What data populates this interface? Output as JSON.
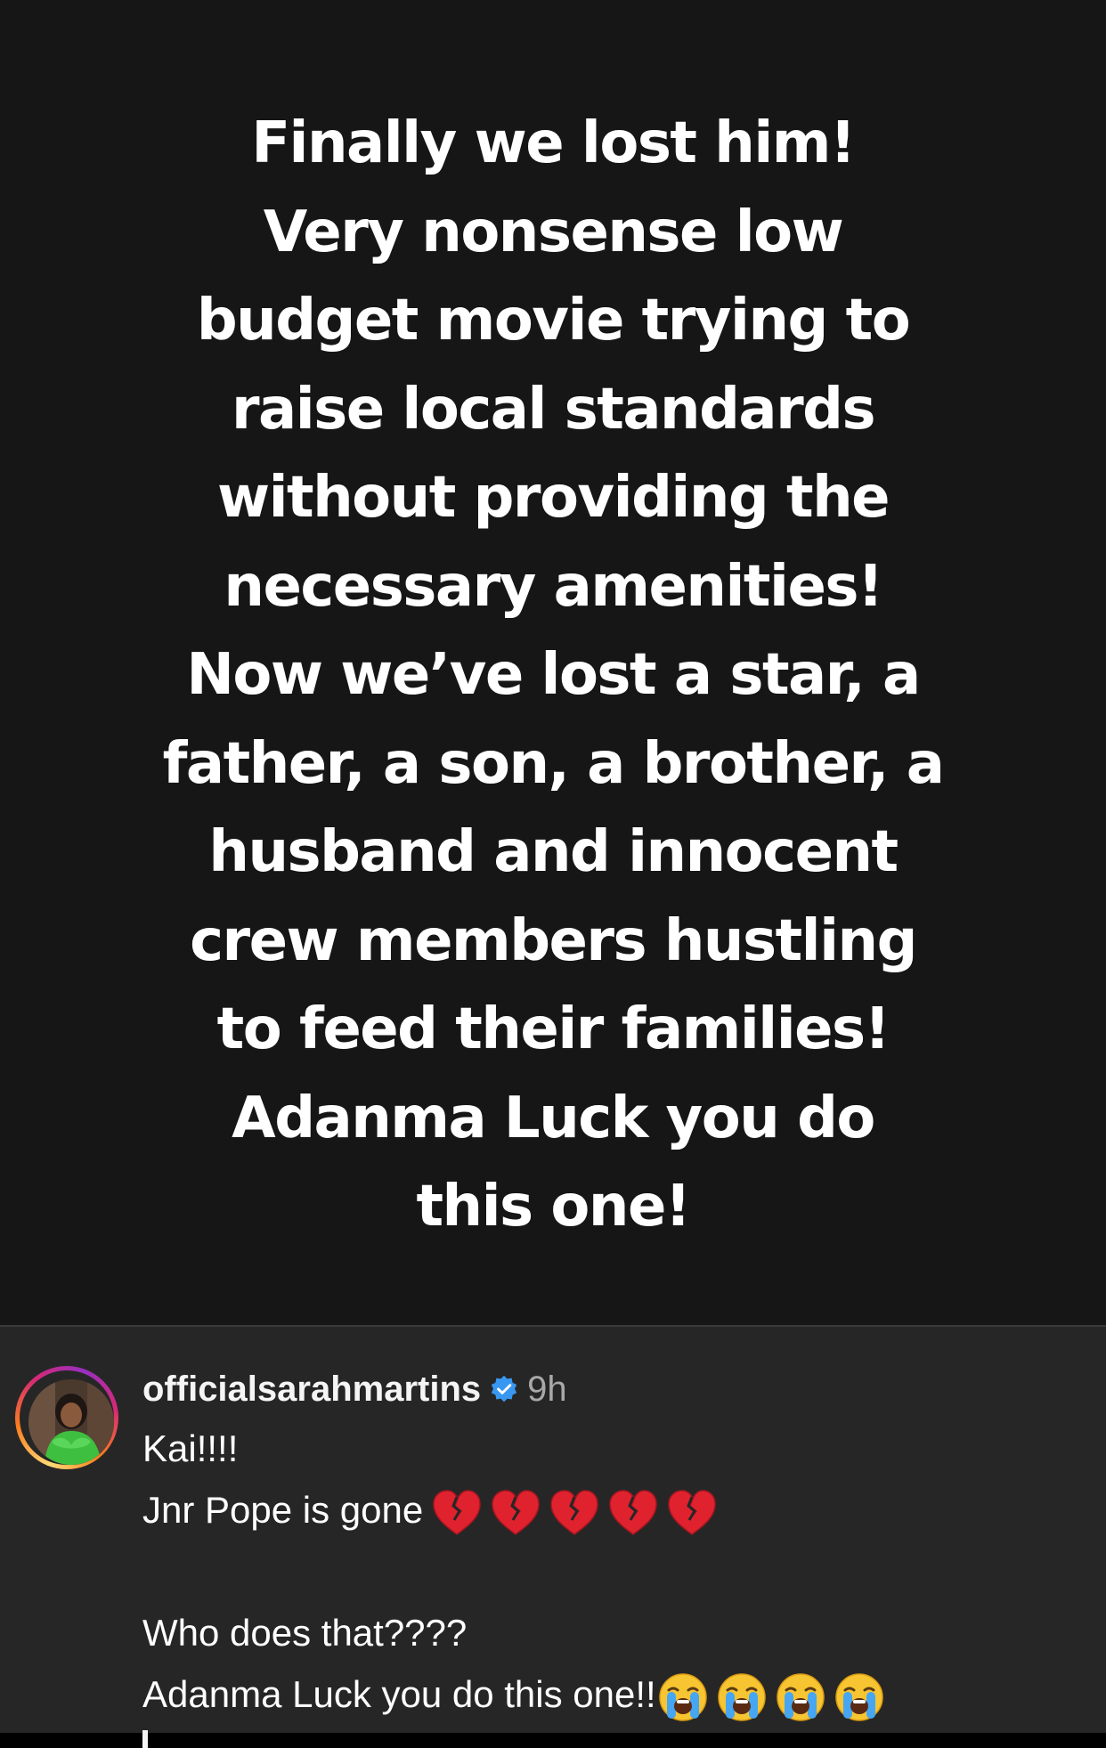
{
  "story": {
    "lines": [
      "Finally we lost him!",
      "Very nonsense low",
      "budget movie trying to",
      "raise local standards",
      "without providing the",
      "necessary amenities!",
      "Now we’ve lost a star, a",
      "father, a son, a brother, a",
      "husband and innocent",
      "crew members hustling",
      "to feed their families!",
      "Adanma Luck you do",
      "this one!"
    ]
  },
  "comment": {
    "username": "officialsarahmartins",
    "verified_icon": "verified-badge-icon",
    "timestamp": "9h",
    "line1": "Kai!!!!",
    "line2": "Jnr Pope is gone",
    "line2_emoji": "broken-heart-icon",
    "line2_emoji_count": 5,
    "line3": "Who does that????",
    "line4": "Adanma Luck you do this one!!",
    "line4_emoji": "loudly-crying-face-icon",
    "line4_emoji_count": 4,
    "colors": {
      "story_bg": "#161616",
      "comment_bg": "#262626",
      "verified": "#3897f0",
      "timestamp": "#a8a8a8"
    }
  }
}
